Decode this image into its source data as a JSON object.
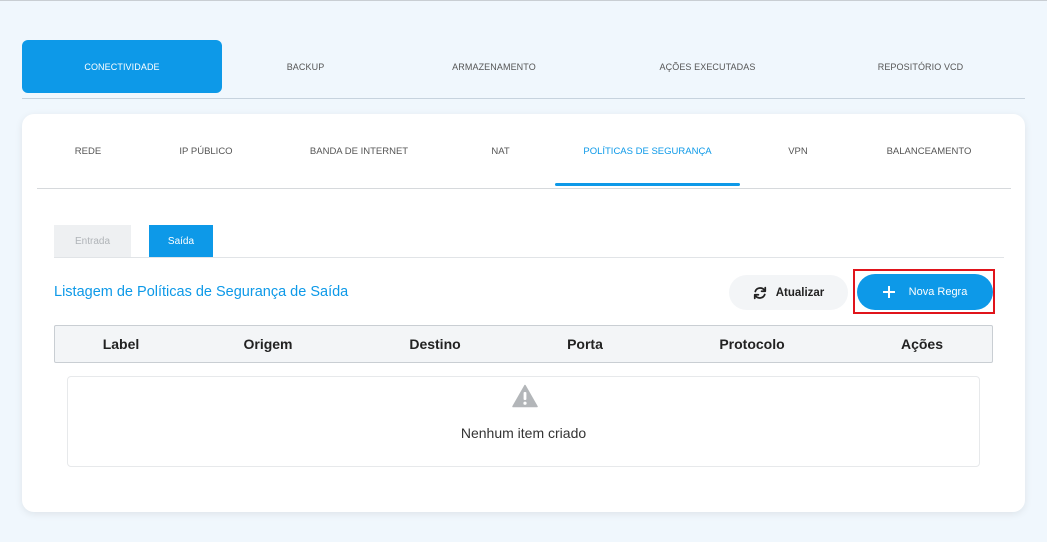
{
  "main_tabs": [
    {
      "label": "CONECTIVIDADE",
      "active": true
    },
    {
      "label": "BACKUP",
      "active": false
    },
    {
      "label": "ARMAZENAMENTO",
      "active": false
    },
    {
      "label": "AÇÕES EXECUTADAS",
      "active": false
    },
    {
      "label": "REPOSITÓRIO VCD",
      "active": false
    }
  ],
  "sub_tabs": [
    {
      "label": "REDE",
      "active": false
    },
    {
      "label": "IP PÚBLICO",
      "active": false
    },
    {
      "label": "BANDA DE INTERNET",
      "active": false
    },
    {
      "label": "NAT",
      "active": false
    },
    {
      "label": "POLÍTICAS DE SEGURANÇA",
      "active": true
    },
    {
      "label": "VPN",
      "active": false
    },
    {
      "label": "BALANCEAMENTO",
      "active": false
    }
  ],
  "direction_tabs": [
    {
      "label": "Entrada",
      "active": false
    },
    {
      "label": "Saída",
      "active": true
    }
  ],
  "list": {
    "title": "Listagem de Políticas de Segurança de Saída",
    "refresh_label": "Atualizar",
    "new_rule_label": "Nova Regra"
  },
  "table": {
    "columns": [
      "Label",
      "Origem",
      "Destino",
      "Porta",
      "Protocolo",
      "Ações"
    ],
    "empty_message": "Nenhum item criado"
  },
  "icons": {
    "refresh": "refresh-icon",
    "plus": "plus-icon",
    "warning": "warning-icon"
  },
  "colors": {
    "accent": "#0d99e8",
    "highlight": "#e0141b"
  }
}
